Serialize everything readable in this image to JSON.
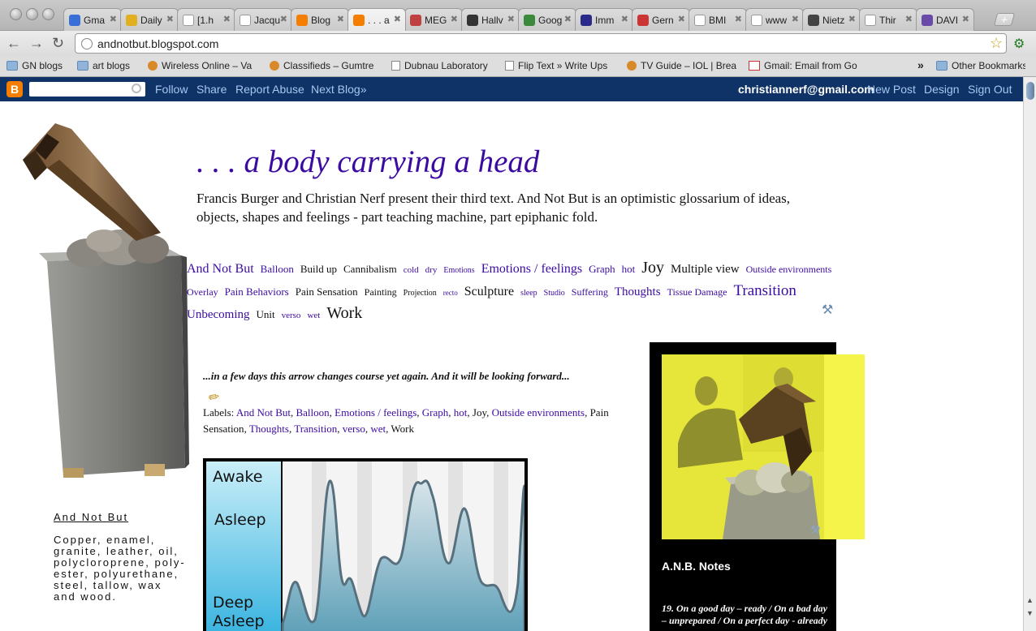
{
  "window": {
    "tabs": [
      {
        "label": "Gma",
        "icon": "loading-icon",
        "color": "#3a6fd8"
      },
      {
        "label": "Daily",
        "icon": "daily-icon",
        "color": "#e0b020"
      },
      {
        "label": "[1.h",
        "icon": "page-icon",
        "color": "#ffffff"
      },
      {
        "label": "Jacqu",
        "icon": "wikipedia-icon",
        "color": "#ffffff"
      },
      {
        "label": "Blog",
        "icon": "blogger-icon",
        "color": "#f57d00"
      },
      {
        "label": ". . . a",
        "icon": "blogger-icon",
        "color": "#f57d00"
      },
      {
        "label": "MEG",
        "icon": "mega-icon",
        "color": "#c04040"
      },
      {
        "label": "Hallv",
        "icon": "s-icon",
        "color": "#333333"
      },
      {
        "label": "Goog",
        "icon": "google-icon",
        "color": "#3b8a3b"
      },
      {
        "label": "Imm",
        "icon": "w-icon",
        "color": "#2a2a8a"
      },
      {
        "label": "Gern",
        "icon": "flag-icon",
        "color": "#cc3333"
      },
      {
        "label": "BMI",
        "icon": "page-icon",
        "color": "#ffffff"
      },
      {
        "label": "www",
        "icon": "page-icon",
        "color": "#ffffff"
      },
      {
        "label": "Nietz",
        "icon": "portrait-icon",
        "color": "#444444"
      },
      {
        "label": "Thir",
        "icon": "page-icon",
        "color": "#ffffff"
      },
      {
        "label": "DAVI",
        "icon": "az-icon",
        "color": "#6a4aa8"
      }
    ],
    "url": "andnotbut.blogspot.com"
  },
  "bookmarks": [
    {
      "label": "GN blogs",
      "type": "folder"
    },
    {
      "label": "art blogs",
      "type": "folder"
    },
    {
      "label": "Wireless Online – Va",
      "type": "site"
    },
    {
      "label": "Classifieds – Gumtre",
      "type": "site"
    },
    {
      "label": "Dubnau Laboratory",
      "type": "page"
    },
    {
      "label": "Flip Text » Write Ups",
      "type": "page"
    },
    {
      "label": "TV Guide – IOL | Brea",
      "type": "site"
    },
    {
      "label": "Gmail: Email from Go",
      "type": "gmail"
    },
    {
      "label": "Other Bookmarks",
      "type": "folder"
    }
  ],
  "bookmarks_more": "»",
  "navbar": {
    "follow": "Follow",
    "share": "Share",
    "report": "Report Abuse",
    "next": "Next Blog»",
    "email": "christiannerf@gmail.com",
    "new_post": "New Post",
    "design": "Design",
    "sign_out": "Sign Out"
  },
  "blog": {
    "title": ". . . a body carrying a head",
    "description": "Francis Burger and Christian Nerf present their third text. And Not But is an optimistic glossarium of ideas, objects, shapes and feelings - part teaching machine, part epiphanic fold."
  },
  "tag_cloud": [
    {
      "t": "And Not But",
      "s": 16,
      "c": "link"
    },
    {
      "t": "Balloon",
      "s": 13,
      "c": "link"
    },
    {
      "t": "Build up",
      "s": 13,
      "c": "dark"
    },
    {
      "t": "Cannibalism",
      "s": 13,
      "c": "dark"
    },
    {
      "t": "cold",
      "s": 11,
      "c": "link"
    },
    {
      "t": "dry",
      "s": 11,
      "c": "link"
    },
    {
      "t": "Emotions",
      "s": 10,
      "c": "link"
    },
    {
      "t": "Emotions / feelings",
      "s": 16,
      "c": "link"
    },
    {
      "t": "Graph",
      "s": 13,
      "c": "link"
    },
    {
      "t": "hot",
      "s": 13,
      "c": "link"
    },
    {
      "t": "Joy",
      "s": 20,
      "c": "dark"
    },
    {
      "t": "Multiple view",
      "s": 15,
      "c": "dark"
    },
    {
      "t": "Outside environments",
      "s": 12,
      "c": "link"
    },
    {
      "t": "Overlay",
      "s": 12,
      "c": "link"
    },
    {
      "t": "Pain Behaviors",
      "s": 13,
      "c": "link"
    },
    {
      "t": "Pain Sensation",
      "s": 13,
      "c": "dark"
    },
    {
      "t": "Painting",
      "s": 12,
      "c": "dark"
    },
    {
      "t": "Projection",
      "s": 10,
      "c": "dark"
    },
    {
      "t": "recto",
      "s": 9,
      "c": "link"
    },
    {
      "t": "Sculpture",
      "s": 16,
      "c": "dark"
    },
    {
      "t": "sleep",
      "s": 10,
      "c": "link"
    },
    {
      "t": "Studio",
      "s": 10,
      "c": "link"
    },
    {
      "t": "Suffering",
      "s": 12,
      "c": "link"
    },
    {
      "t": "Thoughts",
      "s": 15,
      "c": "link"
    },
    {
      "t": "Tissue Damage",
      "s": 12,
      "c": "link"
    },
    {
      "t": "Transition",
      "s": 19,
      "c": "link"
    },
    {
      "t": "Unbecoming",
      "s": 15,
      "c": "link"
    },
    {
      "t": "Unit",
      "s": 13,
      "c": "dark"
    },
    {
      "t": "verso",
      "s": 11,
      "c": "link"
    },
    {
      "t": "wet",
      "s": 11,
      "c": "link"
    },
    {
      "t": "Work",
      "s": 20,
      "c": "dark"
    }
  ],
  "caption": {
    "title": "And Not But",
    "body": "Copper, enamel, granite, leather, oil, polycloroprene, poly-ester, polyurethane, steel, tallow, wax and wood."
  },
  "post": {
    "title": "...in a few days this arrow changes course yet again. And it will be looking forward...",
    "labels_prefix": "Labels:",
    "labels": [
      {
        "t": "And Not But",
        "link": true
      },
      {
        "t": "Balloon",
        "link": true
      },
      {
        "t": "Emotions / feelings",
        "link": true
      },
      {
        "t": "Graph",
        "link": true
      },
      {
        "t": "hot",
        "link": true
      },
      {
        "t": "Joy",
        "link": false
      },
      {
        "t": "Outside environments",
        "link": true
      },
      {
        "t": "Pain Sensation",
        "link": false
      },
      {
        "t": "Thoughts",
        "link": true
      },
      {
        "t": "Transition",
        "link": true
      },
      {
        "t": "verso",
        "link": true
      },
      {
        "t": "wet",
        "link": true
      },
      {
        "t": "Work",
        "link": false
      }
    ]
  },
  "graph": {
    "stage_labels": [
      "Awake",
      "Asleep",
      "Deep",
      "Asleep"
    ]
  },
  "sidebar": {
    "notes_title": "A.N.B. Notes",
    "notes_text": "19. On a good day – ready / On a bad day – unprepared / On a perfect day - already"
  },
  "colors": {
    "link": "#3b0ba1",
    "navbar": "#0f3366",
    "sidebar_bg": "#000000",
    "photo_yellow": "#e8e83a"
  }
}
